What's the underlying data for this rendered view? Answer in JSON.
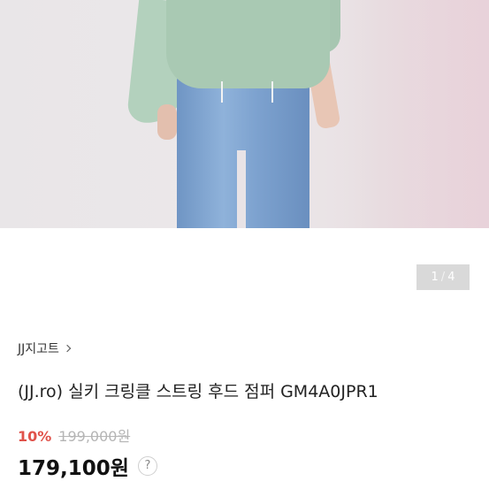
{
  "gallery": {
    "current": "1",
    "total": "4",
    "separator": "/"
  },
  "store": {
    "name": "JJ지고트"
  },
  "product": {
    "title": "(JJ.ro) 실키 크링클 스트링 후드 점퍼 GM4A0JPR1",
    "discount_rate": "10%",
    "original_price": "199,000원",
    "sale_price": "179,100원",
    "help_label": "?"
  },
  "colors": {
    "discount": "#e0524a",
    "pager_bg": "#d9d9d9"
  }
}
